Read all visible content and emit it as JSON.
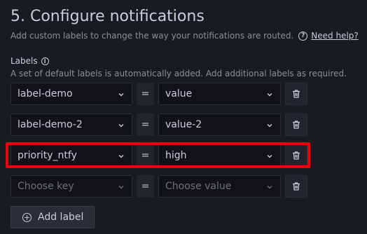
{
  "section": {
    "title": "5. Configure notifications",
    "description": "Add custom labels to change the way your notifications are routed.",
    "help_link": "Need help?",
    "help_icon": "question-circle-icon"
  },
  "labels": {
    "title": "Labels",
    "info_icon": "info-circle-icon",
    "description": "A set of default labels is automatically added. Add additional labels as required.",
    "operator": "=",
    "rows": [
      {
        "key": "label-demo",
        "value": "value",
        "highlighted": false
      },
      {
        "key": "label-demo-2",
        "value": "value-2",
        "highlighted": false
      },
      {
        "key": "priority_ntfy",
        "value": "high",
        "highlighted": true
      },
      {
        "key": "",
        "value": "",
        "key_placeholder": "Choose key",
        "value_placeholder": "Choose value",
        "highlighted": false
      }
    ],
    "add_button": "Add label",
    "highlight_color": "#e8000d"
  }
}
